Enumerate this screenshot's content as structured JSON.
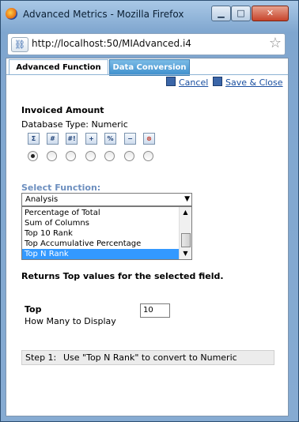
{
  "window": {
    "title": "Advanced Metrics - Mozilla Firefox",
    "min_glyph": "▁",
    "max_glyph": "□",
    "close_glyph": "✕"
  },
  "address_bar": {
    "url": "http://localhost:50/MIAdvanced.i4",
    "site_icon": "link-icon",
    "bookmark_icon": "star-icon"
  },
  "tabs": [
    {
      "label": "Advanced Function",
      "active": true
    },
    {
      "label": "Data Conversion",
      "active": false
    }
  ],
  "actions": {
    "cancel": "Cancel",
    "save_close": "Save & Close"
  },
  "field": {
    "name": "Invoiced Amount",
    "db_type": "Database Type: Numeric"
  },
  "function_buttons": [
    {
      "symbol": "Σ",
      "icon": "sum-icon"
    },
    {
      "symbol": "#",
      "icon": "count-icon"
    },
    {
      "symbol": "#!",
      "icon": "distinct-count-icon"
    },
    {
      "symbol": "+",
      "icon": "add-icon"
    },
    {
      "symbol": "%",
      "icon": "percent-icon"
    },
    {
      "symbol": "−",
      "icon": "subtract-icon"
    },
    {
      "symbol": "⊗",
      "icon": "clear-icon"
    }
  ],
  "radio_selected_index": 0,
  "select_function": {
    "label": "Select Function:",
    "category": "Analysis",
    "options": [
      "Percentage of Total",
      "Sum of Columns",
      "Top 10 Rank",
      "Top Accumulative Percentage",
      "Top N Rank"
    ],
    "selected": "Top N Rank"
  },
  "description": "Returns Top values for the selected field.",
  "top": {
    "label": "Top",
    "sublabel": "How Many to Display",
    "value": "10"
  },
  "step": {
    "number": "Step 1:",
    "message": "Use \"Top N Rank\" to convert to Numeric"
  },
  "colors": {
    "tab_inactive": "#3e8fcd",
    "link": "#1a4fa0",
    "select_label": "#6d8fbf",
    "selection": "#3399ff"
  }
}
